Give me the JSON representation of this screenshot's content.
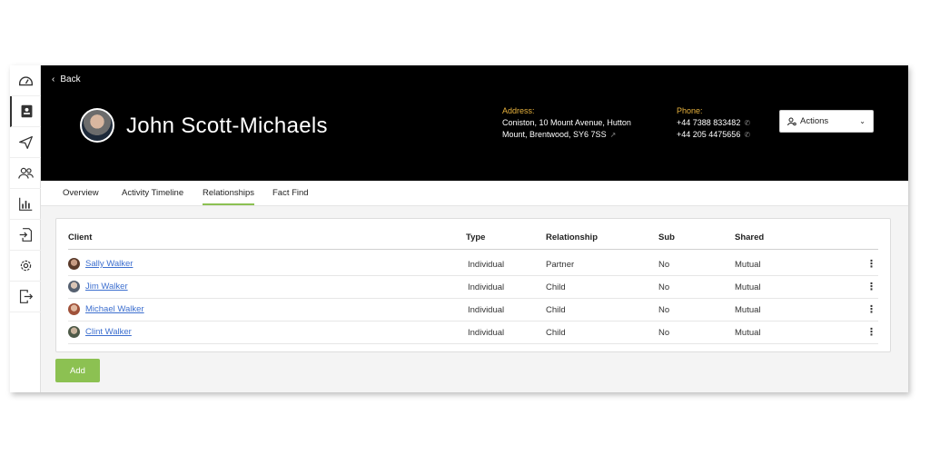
{
  "header": {
    "back_label": "Back",
    "client_name": "John Scott-Michaels",
    "address_label": "Address:",
    "address_line1": "Coniston, 10 Mount Avenue, Hutton",
    "address_line2": "Mount, Brentwood, SY6 7SS",
    "phone_label": "Phone:",
    "phone1": "+44 7388 833482",
    "phone2": "+44 205 4475656",
    "actions_label": "Actions"
  },
  "sidebar": {
    "items": [
      {
        "icon": "dashboard-icon"
      },
      {
        "icon": "contact-card-icon"
      },
      {
        "icon": "send-icon"
      },
      {
        "icon": "users-icon"
      },
      {
        "icon": "bar-chart-icon"
      },
      {
        "icon": "document-import-icon"
      },
      {
        "icon": "gear-icon"
      },
      {
        "icon": "logout-icon"
      }
    ]
  },
  "tabs": [
    {
      "label": "Overview"
    },
    {
      "label": "Activity Timeline"
    },
    {
      "label": "Relationships"
    },
    {
      "label": "Fact Find"
    }
  ],
  "table": {
    "headers": {
      "client": "Client",
      "type": "Type",
      "relationship": "Relationship",
      "sub": "Sub",
      "shared": "Shared"
    },
    "rows": [
      {
        "client": "Sally Walker",
        "type": "Individual",
        "relationship": "Partner",
        "sub": "No",
        "shared": "Mutual"
      },
      {
        "client": "Jim Walker",
        "type": "Individual",
        "relationship": "Child",
        "sub": "No",
        "shared": "Mutual"
      },
      {
        "client": "Michael Walker",
        "type": "Individual",
        "relationship": "Child",
        "sub": "No",
        "shared": "Mutual"
      },
      {
        "client": "Clint Walker",
        "type": "Individual",
        "relationship": "Child",
        "sub": "No",
        "shared": "Mutual"
      }
    ]
  },
  "add_label": "Add",
  "colors": {
    "accent": "#8cc152",
    "address_label": "#e8b23d",
    "link": "#3d6fcf",
    "header_bg": "#000000"
  }
}
